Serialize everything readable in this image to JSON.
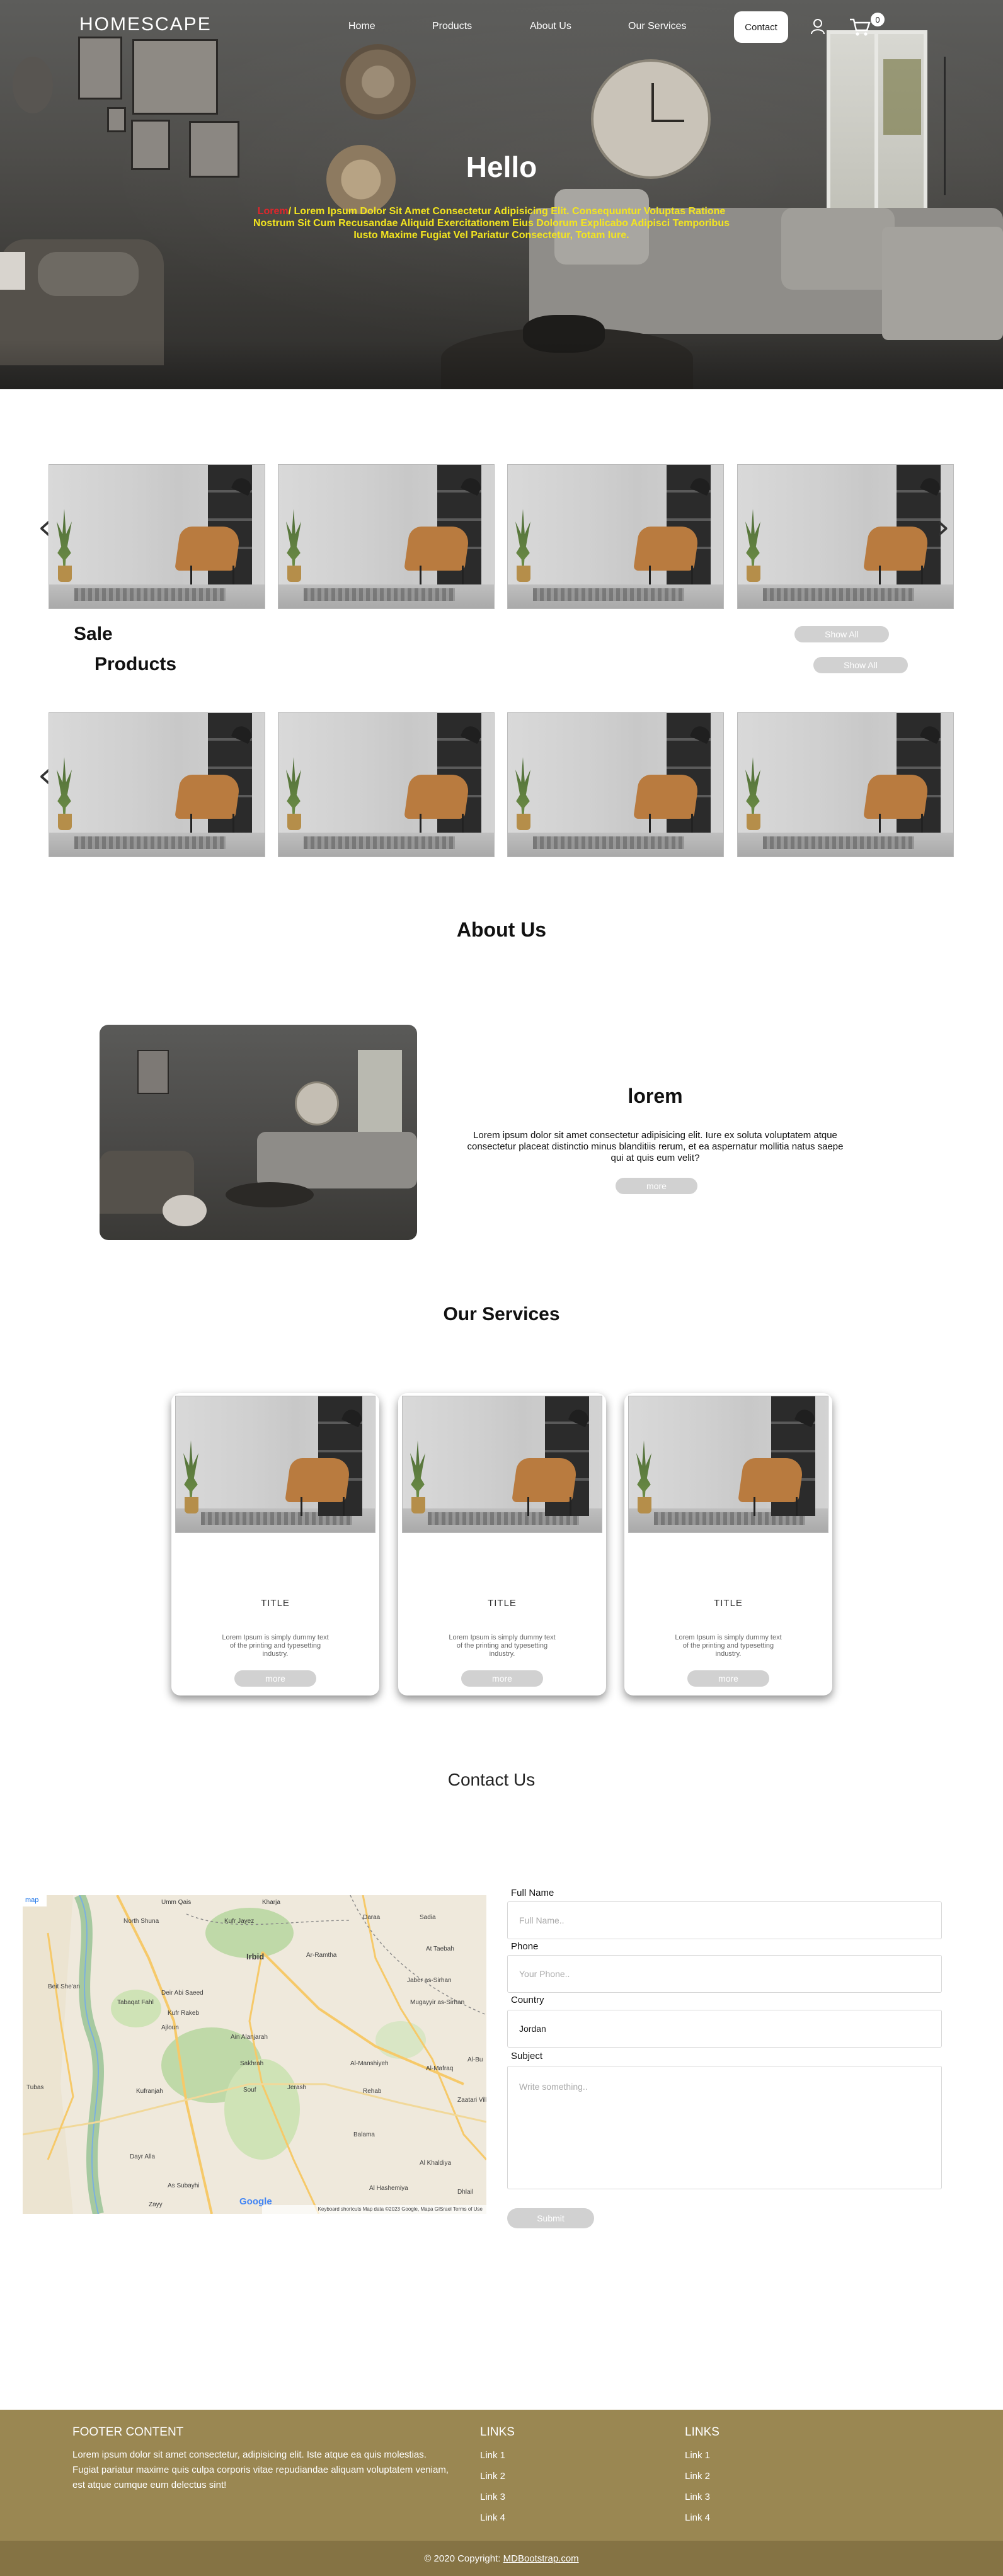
{
  "nav": {
    "brand": "HOMESCAPE",
    "links": [
      "Home",
      "Products",
      "About Us",
      "Our Services"
    ],
    "contact": "Contact",
    "cart_count": "0"
  },
  "hero": {
    "title": "Hello",
    "accent_word": "Lorem",
    "text": "/ Lorem Ipsum Dolor Sit Amet Consectetur Adipisicing Elit. Consequuntur Voluptas Ratione Nostrum Sit Cum Recusandae Aliquid Exercitationem Eius Dolorum Explicabo Adipisci Temporibus Iusto Maxime Fugiat Vel Pariatur Consectetur, Totam Iure."
  },
  "products": {
    "sale_label": "Sale",
    "products_label": "Products",
    "show_all_1": "Show All",
    "show_all_2": "Show All"
  },
  "about": {
    "title": "About Us",
    "heading": "lorem",
    "text": "Lorem ipsum dolor sit amet consectetur adipisicing elit. Iure ex soluta voluptatem atque consectetur placeat distinctio minus blanditiis rerum, et ea aspernatur mollitia natus saepe qui at quis eum velit?",
    "more": "more"
  },
  "services": {
    "title": "Our Services",
    "cards": [
      {
        "title": "TITLE",
        "text": "Lorem Ipsum is simply dummy text of the printing and typesetting industry.",
        "more": "more"
      },
      {
        "title": "TITLE",
        "text": "Lorem Ipsum is simply dummy text of the printing and typesetting industry.",
        "more": "more"
      },
      {
        "title": "TITLE",
        "text": "Lorem Ipsum is simply dummy text of the printing and typesetting industry.",
        "more": "more"
      }
    ]
  },
  "contact": {
    "title": "Contact Us",
    "full_name_label": "Full Name",
    "full_name_placeholder": "Full Name..",
    "phone_label": "Phone",
    "phone_placeholder": "Your Phone..",
    "country_label": "Country",
    "country_value": "Jordan",
    "subject_label": "Subject",
    "subject_placeholder": "Write something..",
    "submit": "Submit"
  },
  "map": {
    "corner_label": "map",
    "google": "Google",
    "attribution": "Keyboard shortcuts   Map data ©2023 Google, Mapa GISrael   Terms of Use",
    "places": [
      {
        "name": "Umm Qais"
      },
      {
        "name": "Kharja"
      },
      {
        "name": "Kufr Jayez"
      },
      {
        "name": "North Shuna"
      },
      {
        "name": "Irbid"
      },
      {
        "name": "Daraa"
      },
      {
        "name": "Sadia"
      },
      {
        "name": "Ar-Ramtha"
      },
      {
        "name": "At Taebah"
      },
      {
        "name": "Beit She'an"
      },
      {
        "name": "Deir Abi Saeed"
      },
      {
        "name": "Tabaqat Fahl"
      },
      {
        "name": "Kufr Rakeb"
      },
      {
        "name": "Jaber as-Sirhan"
      },
      {
        "name": "Mugayyir as-Sirhan"
      },
      {
        "name": "Ajloun"
      },
      {
        "name": "Ain Alanjarah"
      },
      {
        "name": "Sakhrah"
      },
      {
        "name": "Al-Mafraq"
      },
      {
        "name": "Al-Manshiyeh"
      },
      {
        "name": "Kufranjah"
      },
      {
        "name": "Souf"
      },
      {
        "name": "Jerash"
      },
      {
        "name": "Rehab"
      },
      {
        "name": "Zaatari Village"
      },
      {
        "name": "Tubas"
      },
      {
        "name": "Balama"
      },
      {
        "name": "Dayr Alla"
      },
      {
        "name": "As Subayhi"
      },
      {
        "name": "Zayy"
      },
      {
        "name": "Al Khaldiya"
      },
      {
        "name": "Al Hashemiya"
      },
      {
        "name": "Dhlail"
      },
      {
        "name": "Al-Bu"
      }
    ]
  },
  "footer": {
    "content_title": "FOOTER CONTENT",
    "content_text": "Lorem ipsum dolor sit amet consectetur, adipisicing elit. Iste atque ea quis molestias. Fugiat pariatur maxime quis culpa corporis vitae repudiandae aliquam voluptatem veniam, est atque cumque eum delectus sint!",
    "links_col1_title": "LINKS",
    "links_col1": [
      "Link 1",
      "Link 2",
      "Link 3",
      "Link 4"
    ],
    "links_col2_title": "LINKS",
    "links_col2": [
      "Link 1",
      "Link 2",
      "Link 3",
      "Link 4"
    ],
    "copyright": "© 2020 Copyright:",
    "copyright_link": "MDBootstrap.com"
  }
}
